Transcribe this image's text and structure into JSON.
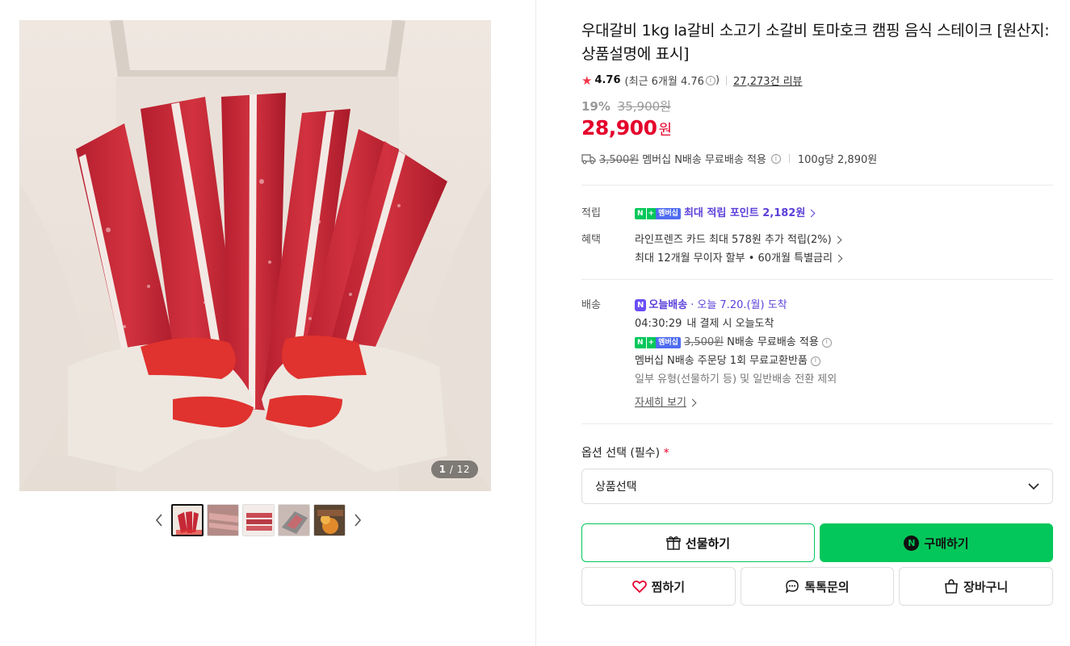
{
  "product": {
    "title": "우대갈비 1kg la갈비 소고기 소갈비 토마호크 캠핑 음식 스테이크 [원산지:상품설명에 표시]",
    "rating": "4.76",
    "rating_recent": "(최근 6개월 4.76",
    "rating_recent_close": ")",
    "review_count": "27,273건 리뷰",
    "discount_pct": "19%",
    "original_price": "35,900원",
    "price": "28,900",
    "price_unit": "원",
    "shipping_fee_strike": "3,500원",
    "shipping_note": "멤버십 N배송 무료배송 적용",
    "unit_price": "100g당 2,890원"
  },
  "gallery": {
    "counter_current": "1",
    "counter_total": "/ 12",
    "thumb_count": 5
  },
  "points": {
    "label": "적립",
    "badge_n": "N",
    "badge_plus": "+",
    "badge_member": "멤버십",
    "text": "최대 적립 포인트 2,182원"
  },
  "benefits": {
    "label": "혜택",
    "items": [
      "라인프렌즈 카드 최대 578원 추가 적립(2%)",
      "최대 12개월 무이자 할부 • 60개월 특별금리"
    ]
  },
  "delivery": {
    "label": "배송",
    "today_badge": "N",
    "today_label": "오늘배송",
    "dot": "·",
    "arrival": "오늘 7.20.(월) 도착",
    "countdown": "04:30:29",
    "countdown_suffix": "내 결제 시 오늘도착",
    "fee_strike": "3,500원",
    "free_note": "N배송 무료배송 적용",
    "exchange_note": "멤버십 N배송 주문당 1회 무료교환반품",
    "exclusion": "일부 유형(선물하기 등) 및 일반배송 전환 제외",
    "detail_link": "자세히 보기"
  },
  "options": {
    "label": "옵션 선택 (필수)",
    "required_mark": "*",
    "select_value": "상품선택"
  },
  "actions": {
    "gift": "선물하기",
    "buy": "구매하기",
    "buy_badge": "N",
    "wish": "찜하기",
    "talk": "톡톡문의",
    "cart": "장바구니"
  },
  "colors": {
    "accent_green": "#03c75a",
    "price_red": "#e4022c",
    "membership_purple": "#5b3fd9"
  }
}
